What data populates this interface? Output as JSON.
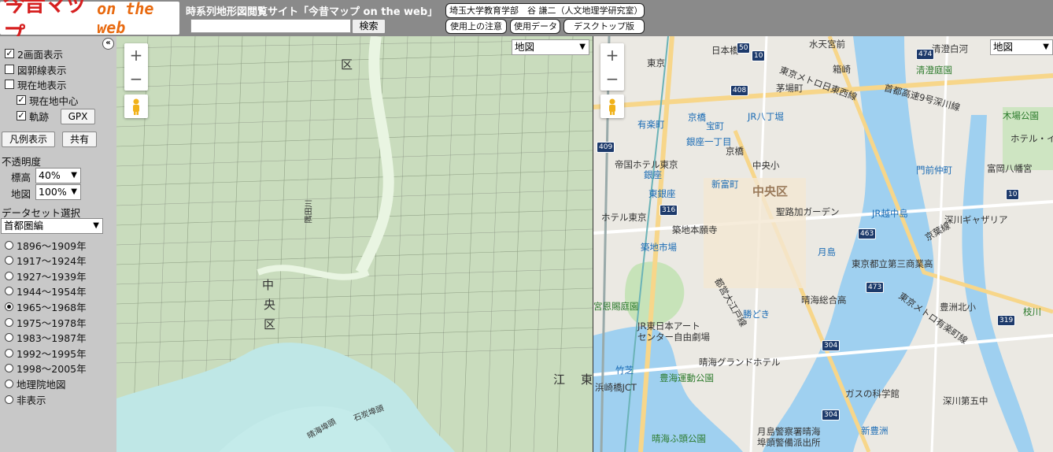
{
  "header": {
    "logo_main": "今昔マップ",
    "logo_sub": "on the web",
    "site_title": "時系列地形図閲覧サイト「今昔マップ on the web」",
    "search_placeholder": "",
    "search_button": "検索",
    "author_link": "埼玉大学教育学部　谷 謙二（人文地理学研究室）",
    "notes_link": "使用上の注意",
    "data_link": "使用データ",
    "desktop_link": "デスクトップ版"
  },
  "sidebar": {
    "collapse_icon": "«",
    "two_screen": {
      "label": "2画面表示",
      "checked": true
    },
    "grid_lines": {
      "label": "図郭線表示",
      "checked": false
    },
    "current_loc": {
      "label": "現在地表示",
      "checked": false
    },
    "current_center": {
      "label": "現在地中心",
      "checked": true
    },
    "track": {
      "label": "軌跡",
      "checked": true
    },
    "gpx_button": "GPX",
    "legend_button": "凡例表示",
    "share_button": "共有",
    "opacity_label": "不透明度",
    "elevation_label": "標高",
    "elevation_value": "40%",
    "map_label": "地図",
    "map_value": "100%",
    "dataset_label": "データセット選択",
    "dataset_value": "首都圏編",
    "periods": [
      {
        "label": "1896～1909年",
        "selected": false
      },
      {
        "label": "1917～1924年",
        "selected": false
      },
      {
        "label": "1927～1939年",
        "selected": false
      },
      {
        "label": "1944～1954年",
        "selected": false
      },
      {
        "label": "1965～1968年",
        "selected": true
      },
      {
        "label": "1975～1978年",
        "selected": false
      },
      {
        "label": "1983～1987年",
        "selected": false
      },
      {
        "label": "1992～1995年",
        "selected": false
      },
      {
        "label": "1998～2005年",
        "selected": false
      },
      {
        "label": "地理院地図",
        "selected": false
      },
      {
        "label": "非表示",
        "selected": false
      }
    ]
  },
  "left_map": {
    "maptype": "地図",
    "zoom_in": "+",
    "zoom_out": "−",
    "labels": [
      "区",
      "中",
      "央",
      "区",
      "江",
      "東",
      "隅田川",
      "晴海埠頭",
      "石炭埠頭"
    ]
  },
  "right_map": {
    "maptype": "地図",
    "zoom_in": "+",
    "zoom_out": "−",
    "labels": {
      "tokyo": "東京",
      "nihonbashi": "日本橋",
      "suiten": "水天宮前",
      "tozai": "東京メトロ日東西線",
      "hakozaki": "箱崎",
      "kiyosumi": "清澄白河",
      "kiyosumi_garden": "清澄庭園",
      "kayabacho": "茅場町",
      "shuto9": "首都高速9号深川線",
      "kibaparkk": "木場公園",
      "hotel_e": "ホテル・イ",
      "kyobashi": "京橋",
      "takaracho": "宝町",
      "hatchobori": "JR八丁堀",
      "yurakucho": "有楽町",
      "ginza1": "銀座一丁目",
      "kyobashi2": "京橋",
      "imperial": "帝国ホテル東京",
      "ginza": "銀座",
      "shintomicho": "新富町",
      "chuoku": "中央区",
      "chuosho": "中央小",
      "monzen": "門前仲町",
      "tomioka": "富岡八幡宮",
      "higashiginza": "東銀座",
      "hotel_tokyo": "ホテル東京",
      "seiroka": "聖路加ガーデン",
      "tsukishima_jr": "JR越中島",
      "fukagawa_gallery": "深川ギャザリア",
      "tsukiji": "築地本願寺",
      "keiyo": "京葉線",
      "tsukijishijo": "築地市場",
      "tsukishima": "月島",
      "daisan": "東京都立第三商業高",
      "hamarikyu": "宮恩賜庭園",
      "oedo": "都営大江戸線",
      "kachidoki": "勝どき",
      "harumi_hs": "晴海総合高",
      "toyosu_kita": "豊洲北小",
      "yurakucho_line": "東京メトロ有楽町線",
      "edagawa": "枝川",
      "jr_east": "JR東日本アート",
      "center": "センター自由劇場",
      "takeshiba": "竹芝",
      "harumi_hotel": "晴海グランドホテル",
      "hamazaki": "浜崎橋JCT",
      "harumi_park": "豊海運動公園",
      "gas": "ガスの科学館",
      "fukagawa5": "深川第五中",
      "shintoyosu": "新豊洲",
      "harumi_futo": "晴海ふ頭公園",
      "police": "月島警察署晴海",
      "police2": "埠頭警備派出所",
      "r408": "408",
      "r316": "316",
      "r463": "463",
      "r473": "473",
      "r304": "304",
      "r319": "319",
      "r474": "474",
      "r10": "10",
      "r409": "409",
      "r50": "50"
    }
  }
}
